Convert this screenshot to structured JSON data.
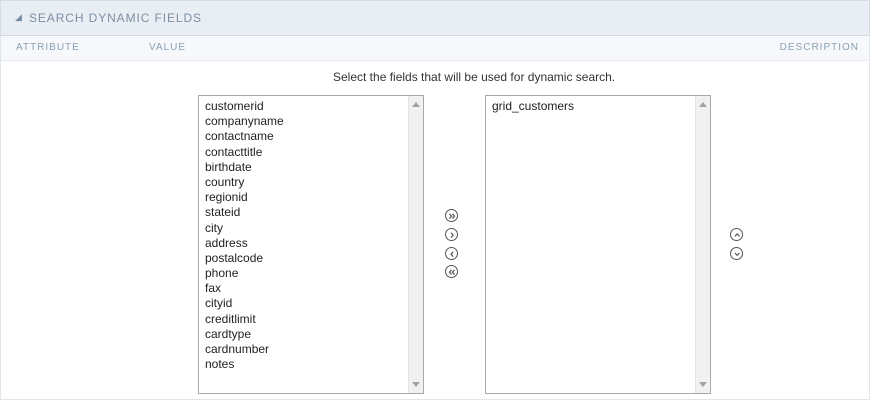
{
  "panel": {
    "title": "SEARCH DYNAMIC FIELDS"
  },
  "columns": {
    "attribute": "ATTRIBUTE",
    "value": "VALUE",
    "description": "DESCRIPTION"
  },
  "instruction": "Select the fields that will be used for dynamic search.",
  "available_fields": [
    "customerid",
    "companyname",
    "contactname",
    "contacttitle",
    "birthdate",
    "country",
    "regionid",
    "stateid",
    "city",
    "address",
    "postalcode",
    "phone",
    "fax",
    "cityid",
    "creditlimit",
    "cardtype",
    "cardnumber",
    "notes"
  ],
  "selected_fields": [
    "grid_customers"
  ],
  "icons": {
    "collapse": "collapse-triangle-icon",
    "add_all": "double-chevron-right-icon",
    "add": "chevron-right-icon",
    "remove": "chevron-left-icon",
    "remove_all": "double-chevron-left-icon",
    "move_up": "chevron-up-icon",
    "move_down": "chevron-down-icon"
  }
}
